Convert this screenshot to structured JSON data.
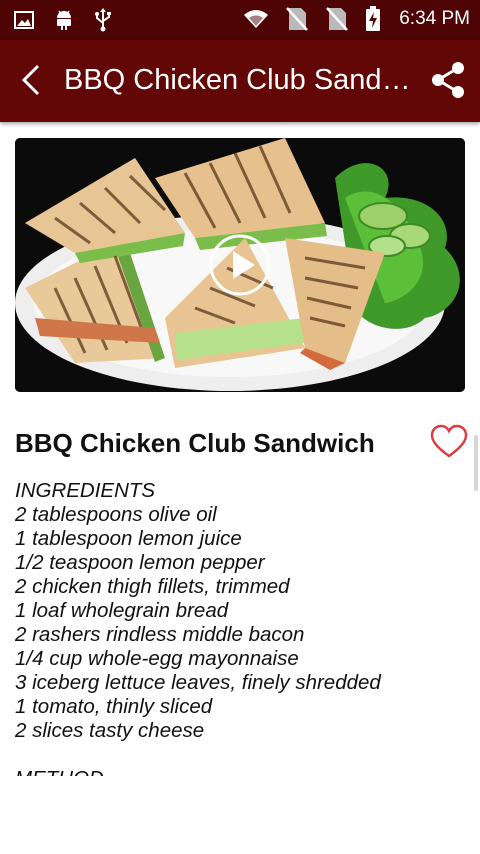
{
  "status_bar": {
    "time": "6:34 PM"
  },
  "app_bar": {
    "title": "BBQ Chicken Club Sandwich"
  },
  "recipe": {
    "title": "BBQ Chicken Club Sandwich",
    "section_ingredients": "INGREDIENTS",
    "ingredients": [
      "2 tablespoons olive oil",
      "1 tablespoon lemon juice",
      "1/2 teaspoon lemon pepper",
      "2 chicken thigh fillets, trimmed",
      "1 loaf wholegrain bread",
      "2 rashers rindless middle bacon",
      "1/4 cup whole-egg mayonnaise",
      "3 iceberg lettuce leaves, finely shredded",
      "1 tomato, thinly sliced",
      "2 slices tasty cheese"
    ],
    "section_method": "METHOD"
  },
  "colors": {
    "appbar": "#620606",
    "statusbar": "#4e0404",
    "heart": "#e0393e"
  },
  "icons": [
    "image-icon",
    "android-icon",
    "usb-icon",
    "wifi-icon",
    "no-sim-icon",
    "no-sim-icon",
    "battery-charging-icon",
    "back-arrow-icon",
    "share-icon",
    "play-icon",
    "heart-outline-icon"
  ]
}
